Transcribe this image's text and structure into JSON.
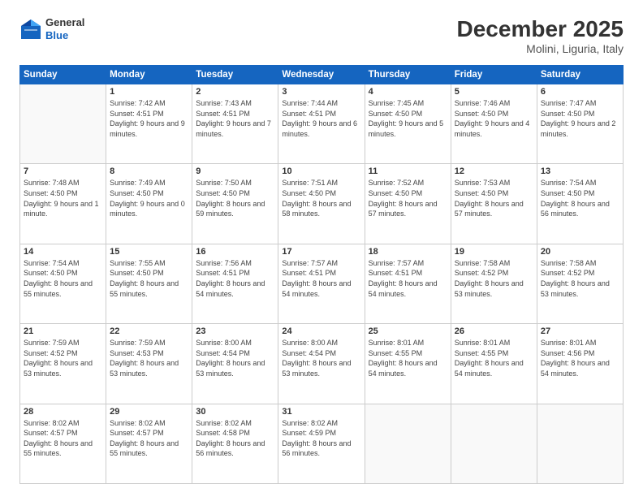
{
  "header": {
    "logo": {
      "line1": "General",
      "line2": "Blue"
    },
    "title": "December 2025",
    "location": "Molini, Liguria, Italy"
  },
  "weekdays": [
    "Sunday",
    "Monday",
    "Tuesday",
    "Wednesday",
    "Thursday",
    "Friday",
    "Saturday"
  ],
  "weeks": [
    [
      {
        "day": "",
        "sunrise": "",
        "sunset": "",
        "daylight": ""
      },
      {
        "day": "1",
        "sunrise": "Sunrise: 7:42 AM",
        "sunset": "Sunset: 4:51 PM",
        "daylight": "Daylight: 9 hours and 9 minutes."
      },
      {
        "day": "2",
        "sunrise": "Sunrise: 7:43 AM",
        "sunset": "Sunset: 4:51 PM",
        "daylight": "Daylight: 9 hours and 7 minutes."
      },
      {
        "day": "3",
        "sunrise": "Sunrise: 7:44 AM",
        "sunset": "Sunset: 4:51 PM",
        "daylight": "Daylight: 9 hours and 6 minutes."
      },
      {
        "day": "4",
        "sunrise": "Sunrise: 7:45 AM",
        "sunset": "Sunset: 4:50 PM",
        "daylight": "Daylight: 9 hours and 5 minutes."
      },
      {
        "day": "5",
        "sunrise": "Sunrise: 7:46 AM",
        "sunset": "Sunset: 4:50 PM",
        "daylight": "Daylight: 9 hours and 4 minutes."
      },
      {
        "day": "6",
        "sunrise": "Sunrise: 7:47 AM",
        "sunset": "Sunset: 4:50 PM",
        "daylight": "Daylight: 9 hours and 2 minutes."
      }
    ],
    [
      {
        "day": "7",
        "sunrise": "Sunrise: 7:48 AM",
        "sunset": "Sunset: 4:50 PM",
        "daylight": "Daylight: 9 hours and 1 minute."
      },
      {
        "day": "8",
        "sunrise": "Sunrise: 7:49 AM",
        "sunset": "Sunset: 4:50 PM",
        "daylight": "Daylight: 9 hours and 0 minutes."
      },
      {
        "day": "9",
        "sunrise": "Sunrise: 7:50 AM",
        "sunset": "Sunset: 4:50 PM",
        "daylight": "Daylight: 8 hours and 59 minutes."
      },
      {
        "day": "10",
        "sunrise": "Sunrise: 7:51 AM",
        "sunset": "Sunset: 4:50 PM",
        "daylight": "Daylight: 8 hours and 58 minutes."
      },
      {
        "day": "11",
        "sunrise": "Sunrise: 7:52 AM",
        "sunset": "Sunset: 4:50 PM",
        "daylight": "Daylight: 8 hours and 57 minutes."
      },
      {
        "day": "12",
        "sunrise": "Sunrise: 7:53 AM",
        "sunset": "Sunset: 4:50 PM",
        "daylight": "Daylight: 8 hours and 57 minutes."
      },
      {
        "day": "13",
        "sunrise": "Sunrise: 7:54 AM",
        "sunset": "Sunset: 4:50 PM",
        "daylight": "Daylight: 8 hours and 56 minutes."
      }
    ],
    [
      {
        "day": "14",
        "sunrise": "Sunrise: 7:54 AM",
        "sunset": "Sunset: 4:50 PM",
        "daylight": "Daylight: 8 hours and 55 minutes."
      },
      {
        "day": "15",
        "sunrise": "Sunrise: 7:55 AM",
        "sunset": "Sunset: 4:50 PM",
        "daylight": "Daylight: 8 hours and 55 minutes."
      },
      {
        "day": "16",
        "sunrise": "Sunrise: 7:56 AM",
        "sunset": "Sunset: 4:51 PM",
        "daylight": "Daylight: 8 hours and 54 minutes."
      },
      {
        "day": "17",
        "sunrise": "Sunrise: 7:57 AM",
        "sunset": "Sunset: 4:51 PM",
        "daylight": "Daylight: 8 hours and 54 minutes."
      },
      {
        "day": "18",
        "sunrise": "Sunrise: 7:57 AM",
        "sunset": "Sunset: 4:51 PM",
        "daylight": "Daylight: 8 hours and 54 minutes."
      },
      {
        "day": "19",
        "sunrise": "Sunrise: 7:58 AM",
        "sunset": "Sunset: 4:52 PM",
        "daylight": "Daylight: 8 hours and 53 minutes."
      },
      {
        "day": "20",
        "sunrise": "Sunrise: 7:58 AM",
        "sunset": "Sunset: 4:52 PM",
        "daylight": "Daylight: 8 hours and 53 minutes."
      }
    ],
    [
      {
        "day": "21",
        "sunrise": "Sunrise: 7:59 AM",
        "sunset": "Sunset: 4:52 PM",
        "daylight": "Daylight: 8 hours and 53 minutes."
      },
      {
        "day": "22",
        "sunrise": "Sunrise: 7:59 AM",
        "sunset": "Sunset: 4:53 PM",
        "daylight": "Daylight: 8 hours and 53 minutes."
      },
      {
        "day": "23",
        "sunrise": "Sunrise: 8:00 AM",
        "sunset": "Sunset: 4:54 PM",
        "daylight": "Daylight: 8 hours and 53 minutes."
      },
      {
        "day": "24",
        "sunrise": "Sunrise: 8:00 AM",
        "sunset": "Sunset: 4:54 PM",
        "daylight": "Daylight: 8 hours and 53 minutes."
      },
      {
        "day": "25",
        "sunrise": "Sunrise: 8:01 AM",
        "sunset": "Sunset: 4:55 PM",
        "daylight": "Daylight: 8 hours and 54 minutes."
      },
      {
        "day": "26",
        "sunrise": "Sunrise: 8:01 AM",
        "sunset": "Sunset: 4:55 PM",
        "daylight": "Daylight: 8 hours and 54 minutes."
      },
      {
        "day": "27",
        "sunrise": "Sunrise: 8:01 AM",
        "sunset": "Sunset: 4:56 PM",
        "daylight": "Daylight: 8 hours and 54 minutes."
      }
    ],
    [
      {
        "day": "28",
        "sunrise": "Sunrise: 8:02 AM",
        "sunset": "Sunset: 4:57 PM",
        "daylight": "Daylight: 8 hours and 55 minutes."
      },
      {
        "day": "29",
        "sunrise": "Sunrise: 8:02 AM",
        "sunset": "Sunset: 4:57 PM",
        "daylight": "Daylight: 8 hours and 55 minutes."
      },
      {
        "day": "30",
        "sunrise": "Sunrise: 8:02 AM",
        "sunset": "Sunset: 4:58 PM",
        "daylight": "Daylight: 8 hours and 56 minutes."
      },
      {
        "day": "31",
        "sunrise": "Sunrise: 8:02 AM",
        "sunset": "Sunset: 4:59 PM",
        "daylight": "Daylight: 8 hours and 56 minutes."
      },
      {
        "day": "",
        "sunrise": "",
        "sunset": "",
        "daylight": ""
      },
      {
        "day": "",
        "sunrise": "",
        "sunset": "",
        "daylight": ""
      },
      {
        "day": "",
        "sunrise": "",
        "sunset": "",
        "daylight": ""
      }
    ]
  ]
}
